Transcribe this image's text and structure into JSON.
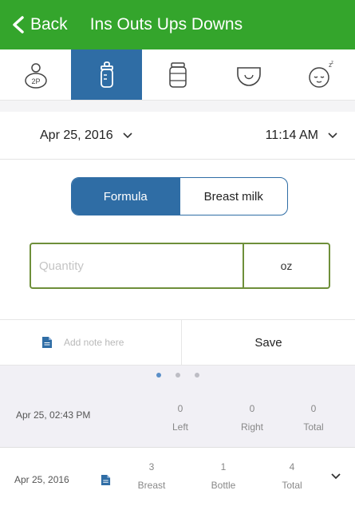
{
  "nav": {
    "back_label": "Back",
    "title": "Ins Outs Ups Downs",
    "color": "#34a52c"
  },
  "tabs": [
    {
      "name": "baby-face-icon",
      "active": false
    },
    {
      "name": "bottle-icon",
      "active": true
    },
    {
      "name": "jar-icon",
      "active": false
    },
    {
      "name": "diaper-icon",
      "active": false
    },
    {
      "name": "sleeping-baby-icon",
      "active": false
    }
  ],
  "datetime": {
    "date": "Apr 25, 2016",
    "time": "11:14 AM"
  },
  "segment": {
    "formula": "Formula",
    "breast_milk": "Breast milk",
    "selected": "Formula",
    "accent": "#2f6da5"
  },
  "quantity": {
    "placeholder": "Quantity",
    "value": "",
    "unit": "oz"
  },
  "note": {
    "placeholder": "Add note here",
    "save": "Save"
  },
  "pager": {
    "count": 3,
    "active": 0
  },
  "feed": {
    "time": "Apr 25, 02:43 PM",
    "left": {
      "value": "0",
      "label": "Left"
    },
    "right": {
      "value": "0",
      "label": "Right"
    },
    "total": {
      "value": "0",
      "label": "Total"
    }
  },
  "summary": {
    "date": "Apr 25, 2016",
    "breast": {
      "value": "3",
      "label": "Breast"
    },
    "bottle": {
      "value": "1",
      "label": "Bottle"
    },
    "total": {
      "value": "4",
      "label": "Total"
    }
  }
}
